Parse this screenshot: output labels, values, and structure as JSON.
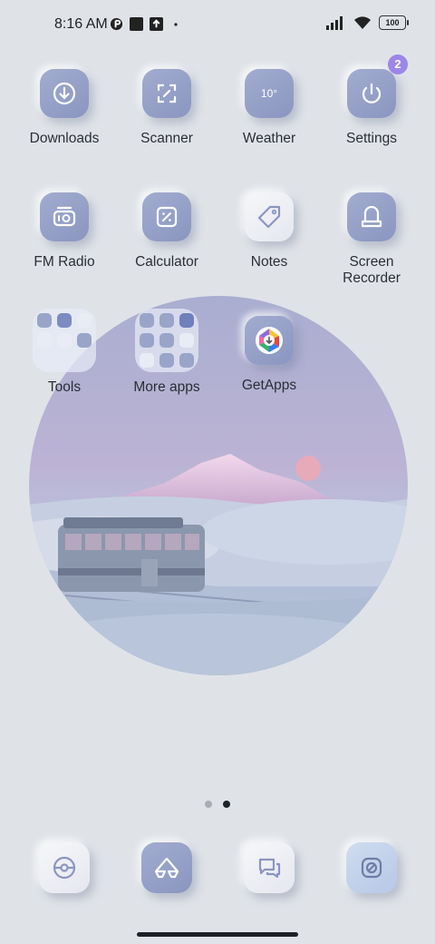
{
  "status_bar": {
    "time": "8:16 AM",
    "battery": "100"
  },
  "apps": [
    {
      "id": "downloads",
      "label": "Downloads",
      "icon": "download-icon"
    },
    {
      "id": "scanner",
      "label": "Scanner",
      "icon": "scan-icon"
    },
    {
      "id": "weather",
      "label": "Weather",
      "icon": "weather-icon",
      "icon_text": "10°"
    },
    {
      "id": "settings",
      "label": "Settings",
      "icon": "power-icon",
      "badge": "2"
    },
    {
      "id": "fm-radio",
      "label": "FM Radio",
      "icon": "radio-icon"
    },
    {
      "id": "calculator",
      "label": "Calculator",
      "icon": "calculator-icon"
    },
    {
      "id": "notes",
      "label": "Notes",
      "icon": "tag-icon"
    },
    {
      "id": "screen-recorder",
      "label": "Screen\nRecorder",
      "icon": "recorder-icon"
    },
    {
      "id": "tools",
      "label": "Tools",
      "icon": "folder-icon"
    },
    {
      "id": "more-apps",
      "label": "More apps",
      "icon": "folder-icon"
    },
    {
      "id": "getapps",
      "label": "GetApps",
      "icon": "getapps-icon"
    }
  ],
  "page_indicator": {
    "pages": 2,
    "active": 2
  },
  "dock": [
    {
      "id": "dock-1",
      "icon": "compass-icon"
    },
    {
      "id": "dock-2",
      "icon": "browser-icon"
    },
    {
      "id": "dock-3",
      "icon": "messages-icon"
    },
    {
      "id": "dock-4",
      "icon": "camera-icon"
    }
  ],
  "colors": {
    "background": "#dfe3e8",
    "tile": "#97a2c8",
    "badge": "#9d86e8"
  }
}
